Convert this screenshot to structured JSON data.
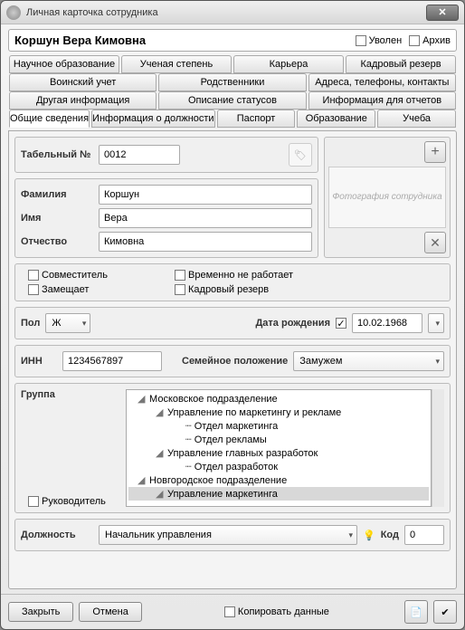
{
  "window": {
    "title": "Личная карточка сотрудника"
  },
  "employee": {
    "full_name": "Коршун Вера Кимовна"
  },
  "header_checks": {
    "fired": "Уволен",
    "archive": "Архив"
  },
  "tab_rows": [
    [
      "Научное образование",
      "Ученая степень",
      "Карьера",
      "Кадровый резерв"
    ],
    [
      "Воинский учет",
      "Родственники",
      "Адреса, телефоны, контакты"
    ],
    [
      "Другая информация",
      "Описание статусов",
      "Информация для отчетов"
    ],
    [
      "Общие сведения",
      "Информация о должности",
      "Паспорт",
      "Образование",
      "Учеба"
    ]
  ],
  "active_tab": "Общие сведения",
  "labels": {
    "tab_number": "Табельный №",
    "surname": "Фамилия",
    "name": "Имя",
    "patronymic": "Отчество",
    "photo_placeholder": "Фотография сотрудника",
    "part_time": "Совместитель",
    "temporarily": "Временно не работает",
    "substitute": "Замещает",
    "reserve": "Кадровый резерв",
    "sex": "Пол",
    "birth_date": "Дата рождения",
    "inn": "ИНН",
    "family": "Семейное положение",
    "group": "Группа",
    "manager": "Руководитель",
    "position": "Должность",
    "code": "Код",
    "copy": "Копировать данные",
    "close": "Закрыть",
    "cancel": "Отмена"
  },
  "values": {
    "tab_number": "0012",
    "surname": "Коршун",
    "name": "Вера",
    "patronymic": "Кимовна",
    "sex": "Ж",
    "birth_date": "10.02.1968",
    "birth_date_checked": true,
    "inn": "1234567897",
    "family": "Замужем",
    "position": "Начальник управления",
    "code": "0"
  },
  "tree": [
    {
      "level": 1,
      "exp": "◢",
      "text": "Московское подразделение"
    },
    {
      "level": 2,
      "exp": "◢",
      "text": "Управление по маркетингу и рекламе"
    },
    {
      "level": 3,
      "exp": "",
      "text": "Отдел маркетинга"
    },
    {
      "level": 3,
      "exp": "",
      "text": "Отдел рекламы"
    },
    {
      "level": 2,
      "exp": "◢",
      "text": "Управление главных разработок"
    },
    {
      "level": 3,
      "exp": "",
      "text": "Отдел разработок"
    },
    {
      "level": 1,
      "exp": "◢",
      "text": "Новгородское подразделение"
    },
    {
      "level": 2,
      "exp": "◢",
      "text": "Управление маркетинга",
      "selected": true
    }
  ]
}
